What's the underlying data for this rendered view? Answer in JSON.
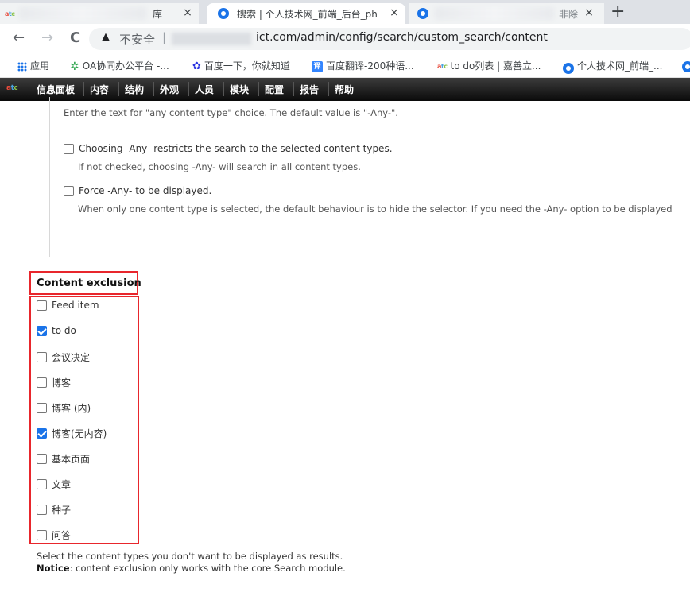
{
  "browser": {
    "tabs": [
      {
        "title": "库",
        "close": "×"
      },
      {
        "title": "搜索 | 个人技术网_前端_后台_ph",
        "close": "×"
      },
      {
        "title": "非除",
        "close": "×"
      }
    ],
    "new_tab": "+",
    "nav": {
      "back": "←",
      "forward": "→",
      "reload": "C"
    },
    "omnibox": {
      "security_icon": "▲",
      "security_label": "不安全",
      "separator": "|",
      "url": "ict.com/admin/config/search/custom_search/content"
    }
  },
  "bookmarks": [
    {
      "icon": "apps-icon",
      "label": "应用"
    },
    {
      "icon": "oa-icon",
      "label": "OA协同办公平台 -..."
    },
    {
      "icon": "baidu-icon",
      "label": "百度一下，你就知道"
    },
    {
      "icon": "fanyi-icon",
      "glyph": "译",
      "label": "百度翻译-200种语..."
    },
    {
      "icon": "atc-icon",
      "label": "to do列表 | 嘉善立..."
    },
    {
      "icon": "drupal-icon",
      "label": "个人技术网_前端_..."
    }
  ],
  "admin_menu": {
    "logo": "atc",
    "items": [
      "信息面板",
      "内容",
      "结构",
      "外观",
      "人员",
      "模块",
      "配置",
      "报告",
      "帮助"
    ]
  },
  "any_settings": {
    "any_text_desc": "Enter the text for \"any content type\" choice. The default value is \"-Any-\".",
    "restrict": {
      "label": "Choosing -Any- restricts the search to the selected content types.",
      "desc": "If not checked, choosing -Any- will search in all content types.",
      "checked": false
    },
    "force": {
      "label": "Force -Any- to be displayed.",
      "desc": "When only one content type is selected, the default behaviour is to hide the selector. If you need the -Any- option to be displayed",
      "checked": false
    }
  },
  "content_exclusion": {
    "title": "Content exclusion",
    "items": [
      {
        "label": "Feed item",
        "checked": false
      },
      {
        "label": "to do",
        "checked": true
      },
      {
        "label": "会议决定",
        "checked": false
      },
      {
        "label": "博客",
        "checked": false
      },
      {
        "label": "博客 (内)",
        "checked": false
      },
      {
        "label": "博客(无内容)",
        "checked": true
      },
      {
        "label": "基本页面",
        "checked": false
      },
      {
        "label": "文章",
        "checked": false
      },
      {
        "label": "种子",
        "checked": false
      },
      {
        "label": "问答",
        "checked": false
      }
    ],
    "help_text": "Select the content types you don't want to be displayed as results.",
    "notice_label": "Notice",
    "notice_text": ": content exclusion only works with the core Search module."
  },
  "colors": {
    "highlight_box": "#e8262c",
    "checkbox_checked": "#1a73e8",
    "admin_bar": "#111111"
  }
}
